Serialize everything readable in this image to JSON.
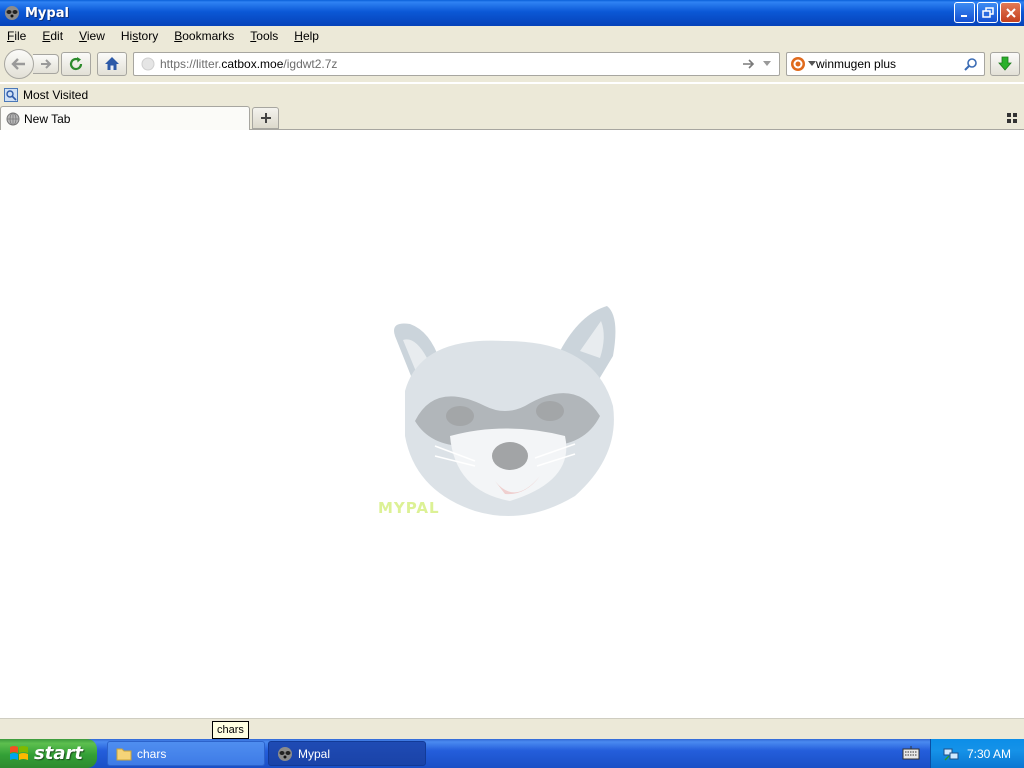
{
  "window": {
    "title": "Mypal"
  },
  "menu": {
    "items": [
      {
        "pre": "",
        "u": "F",
        "post": "ile"
      },
      {
        "pre": "",
        "u": "E",
        "post": "dit"
      },
      {
        "pre": "",
        "u": "V",
        "post": "iew"
      },
      {
        "pre": "Hi",
        "u": "s",
        "post": "tory"
      },
      {
        "pre": "",
        "u": "B",
        "post": "ookmarks"
      },
      {
        "pre": "",
        "u": "T",
        "post": "ools"
      },
      {
        "pre": "",
        "u": "H",
        "post": "elp"
      }
    ]
  },
  "urlbar": {
    "prefix": "https://litter.",
    "host": "catbox.moe",
    "path": "/igdwt2.7z"
  },
  "search": {
    "value": "winmugen plus"
  },
  "bookmarks": {
    "most_visited": "Most Visited"
  },
  "tabs": {
    "active_label": "New Tab"
  },
  "content": {
    "logo_text": "MYPAL"
  },
  "tooltip": {
    "text": "chars"
  },
  "taskbar": {
    "start_label": "start",
    "tasks": [
      {
        "label": "chars"
      },
      {
        "label": "Mypal"
      }
    ],
    "clock": "7:30 AM"
  },
  "colors": {
    "titlebar": "#0b58d6",
    "chrome": "#ece9d8",
    "taskbar": "#245edb",
    "start": "#33a036"
  }
}
